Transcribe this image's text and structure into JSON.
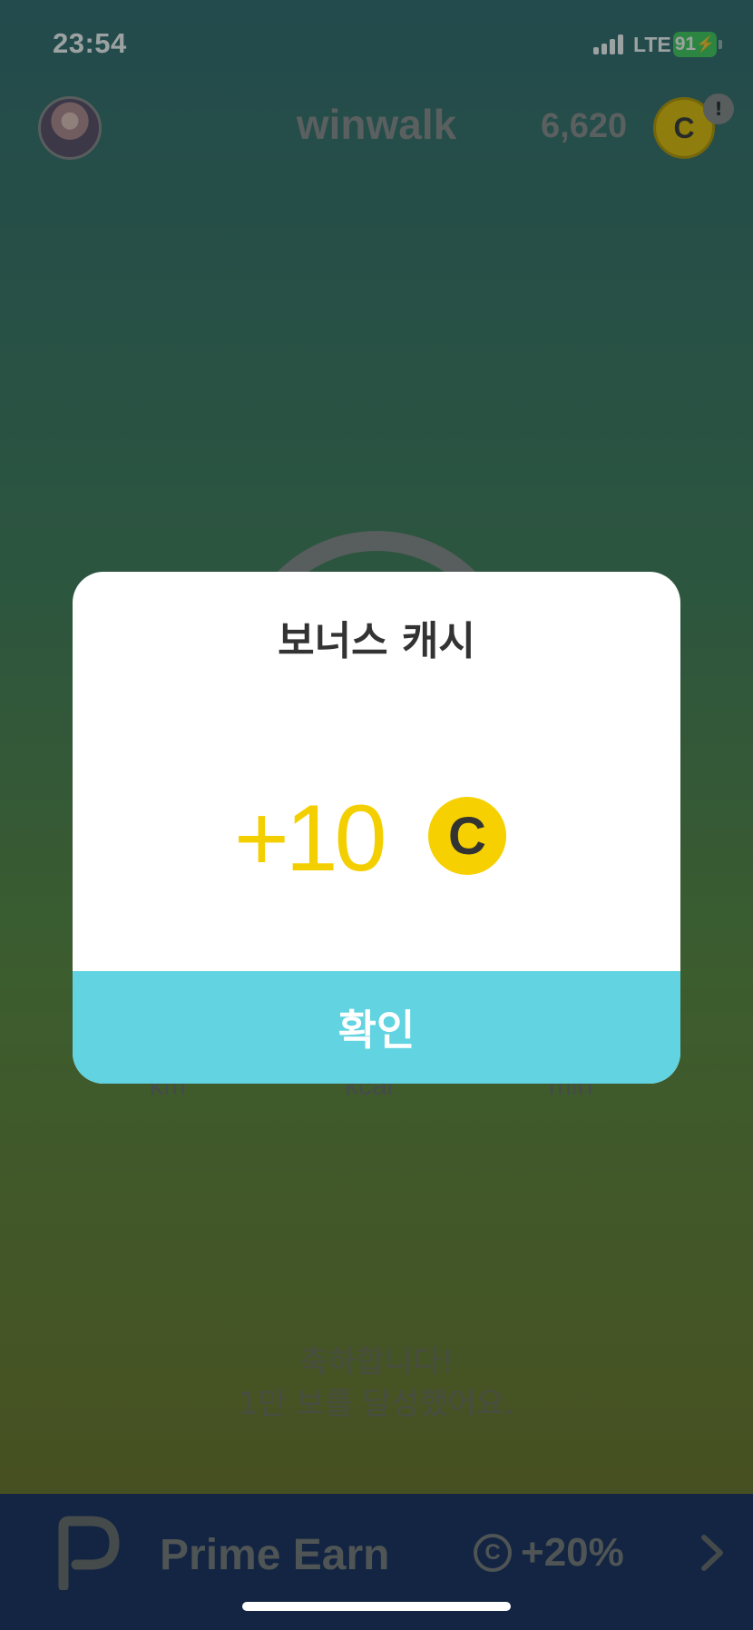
{
  "status_bar": {
    "time": "23:54",
    "network": "LTE",
    "battery": "91"
  },
  "header": {
    "app_title": "winwalk",
    "coin_balance": "6,620",
    "coin_symbol": "C",
    "alert_badge": "!"
  },
  "stats": {
    "distance_unit": "km",
    "calories_unit": "kcal",
    "time_unit": "min"
  },
  "congrats": {
    "line1": "축하합니다!",
    "line2": "1만 보를 달성했어요."
  },
  "promo_banner": {
    "brand": "Prime Earn",
    "coin_symbol": "C",
    "bonus": "+20%",
    "icon": "chevron-right-icon"
  },
  "modal": {
    "title": "보너스 캐시",
    "reward_amount": "+10",
    "coin_symbol": "C",
    "confirm_label": "확인"
  },
  "colors": {
    "accent_yellow": "#f4cf00",
    "confirm_cyan": "#62d3e0",
    "banner_navy": "#132a5e"
  }
}
